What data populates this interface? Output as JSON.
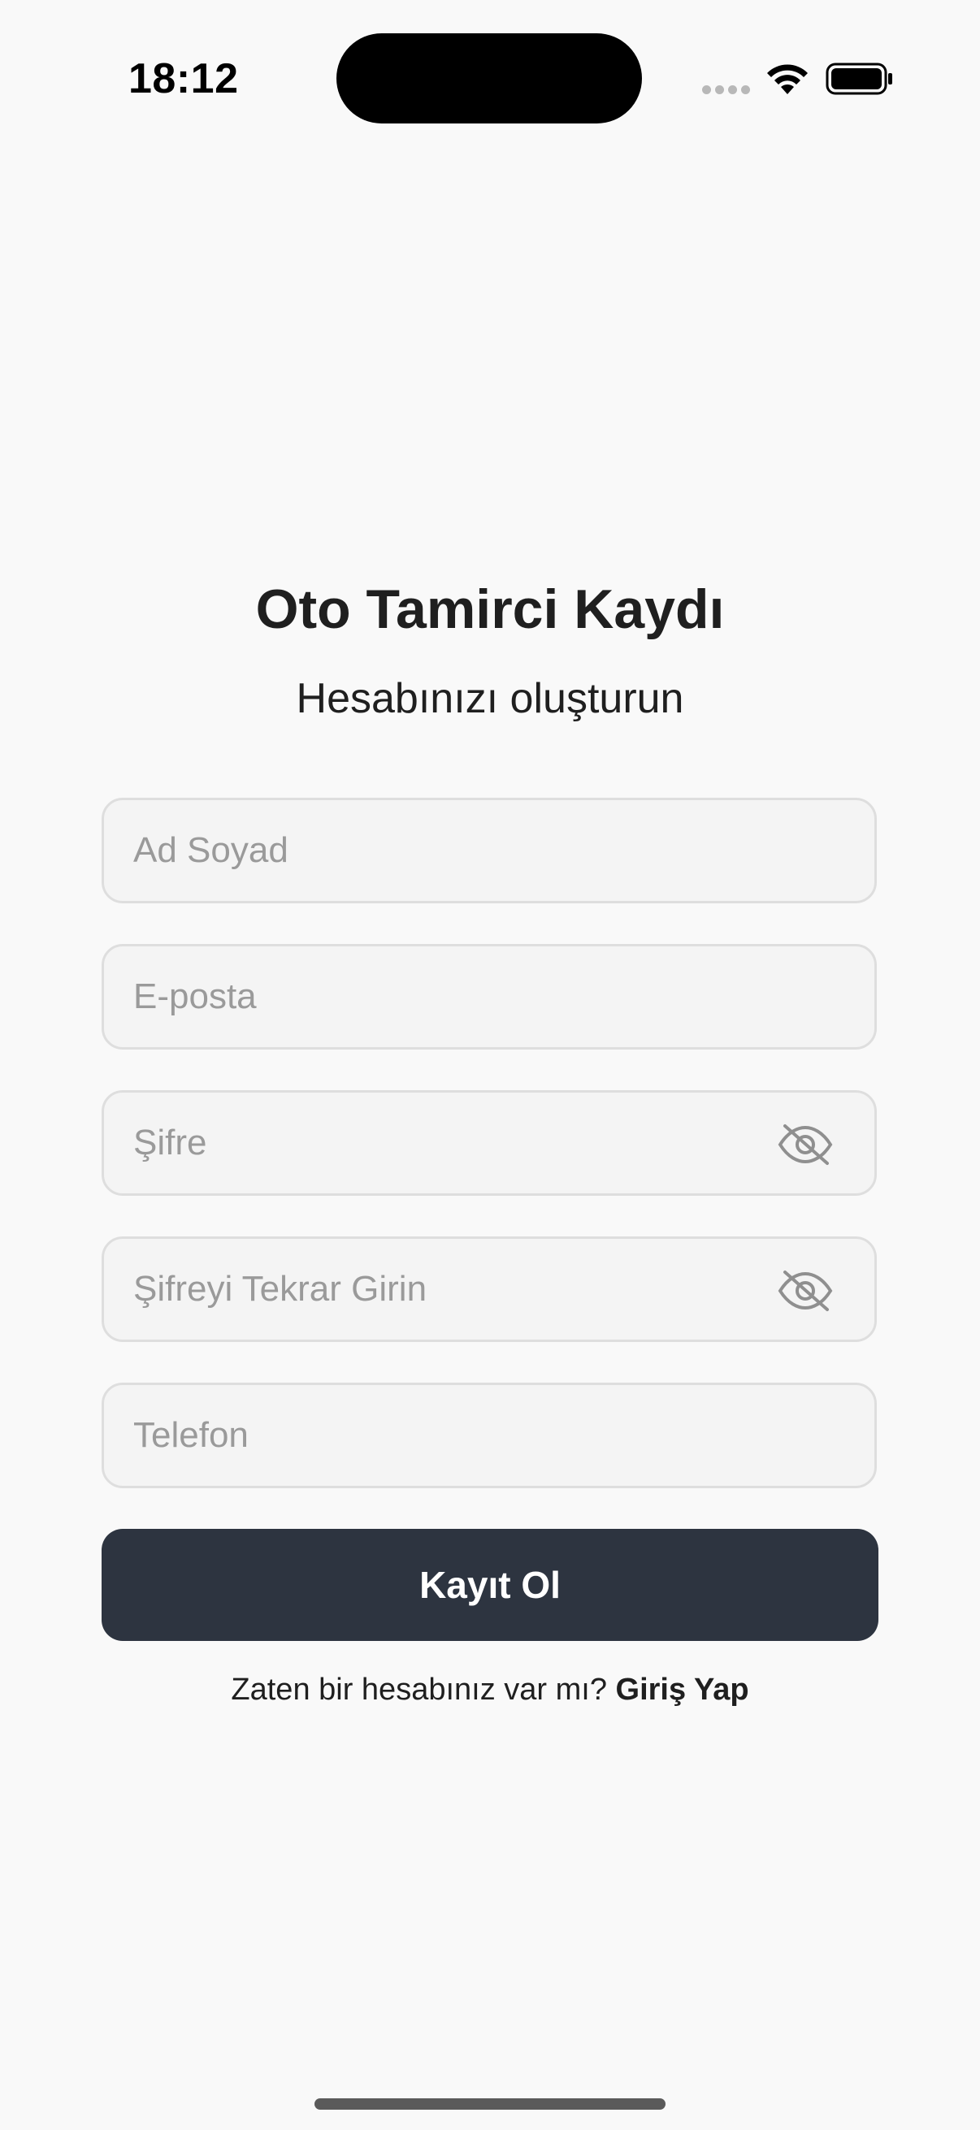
{
  "status_bar": {
    "time": "18:12",
    "icons": [
      "signal-icon",
      "wifi-icon",
      "battery-icon"
    ]
  },
  "header": {
    "title": "Oto Tamirci Kaydı",
    "subtitle": "Hesabınızı oluşturun"
  },
  "form": {
    "full_name": {
      "value": "",
      "placeholder": "Ad Soyad"
    },
    "email": {
      "value": "",
      "placeholder": "E-posta"
    },
    "password": {
      "value": "",
      "placeholder": "Şifre",
      "toggle_icon": "eye-off-icon"
    },
    "password_repeat": {
      "value": "",
      "placeholder": "Şifreyi Tekrar Girin",
      "toggle_icon": "eye-off-icon"
    },
    "phone": {
      "value": "",
      "placeholder": "Telefon"
    },
    "submit_label": "Kayıt Ol"
  },
  "footer": {
    "prompt": "Zaten bir hesabınız var mı?",
    "login_link": "Giriş Yap"
  },
  "colors": {
    "background": "#f9f9f9",
    "field_background": "#f4f4f4",
    "field_border": "#dedede",
    "button": "#2d3440",
    "placeholder": "#9a9a9a",
    "text": "#1f1f1f"
  }
}
